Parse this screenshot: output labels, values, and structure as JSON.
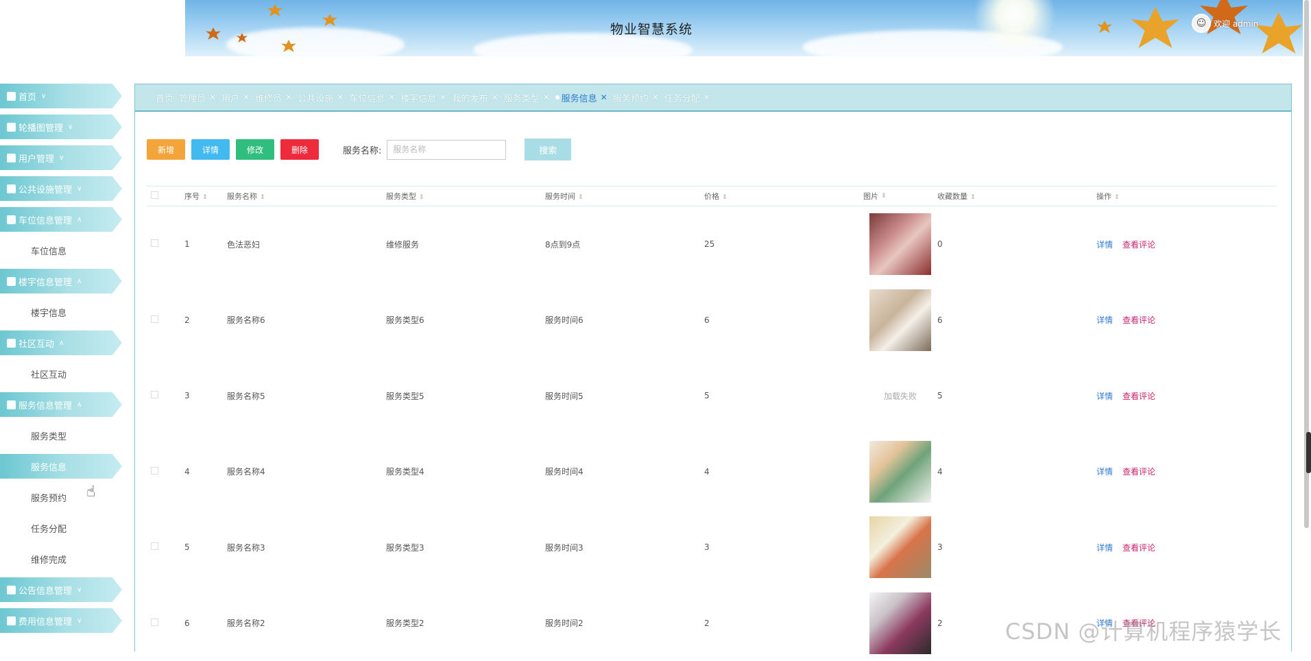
{
  "header": {
    "title": "物业智慧系统",
    "welcome": "欢迎 admin",
    "avatar_icon": "user-avatar-icon"
  },
  "sidebar": {
    "items": [
      {
        "label": "首页",
        "icon": "home-icon",
        "expanded": false,
        "children": []
      },
      {
        "label": "轮播图管理",
        "icon": "carousel-icon",
        "expanded": false,
        "children": []
      },
      {
        "label": "用户管理",
        "icon": "user-icon",
        "expanded": false,
        "children": []
      },
      {
        "label": "公共设施管理",
        "icon": "facility-icon",
        "expanded": false,
        "children": []
      },
      {
        "label": "车位信息管理",
        "icon": "car-icon",
        "expanded": true,
        "children": [
          "车位信息"
        ]
      },
      {
        "label": "楼宇信息管理",
        "icon": "building-icon",
        "expanded": true,
        "children": [
          "楼宇信息"
        ]
      },
      {
        "label": "社区互动",
        "icon": "community-icon",
        "expanded": true,
        "children": [
          "社区互动"
        ]
      },
      {
        "label": "服务信息管理",
        "icon": "service-icon",
        "expanded": true,
        "children": [
          "服务类型",
          "服务信息",
          "服务预约",
          "任务分配",
          "维修完成"
        ]
      },
      {
        "label": "公告信息管理",
        "icon": "notice-icon",
        "expanded": false,
        "children": []
      },
      {
        "label": "费用信息管理",
        "icon": "fee-icon",
        "expanded": false,
        "children": []
      }
    ],
    "active_child": "服务信息"
  },
  "tabs": [
    {
      "label": "首页",
      "closable": false
    },
    {
      "label": "管理员",
      "closable": true
    },
    {
      "label": "用户",
      "closable": true
    },
    {
      "label": "维修员",
      "closable": true
    },
    {
      "label": "公共设施",
      "closable": true
    },
    {
      "label": "车位信息",
      "closable": true
    },
    {
      "label": "楼宇信息",
      "closable": true
    },
    {
      "label": "我的发布",
      "closable": true
    },
    {
      "label": "服务类型",
      "closable": true
    },
    {
      "label": "服务信息",
      "closable": true,
      "active": true
    },
    {
      "label": "服务预约",
      "closable": true
    },
    {
      "label": "任务分配",
      "closable": true
    }
  ],
  "toolbar": {
    "add_label": "新增",
    "detail_label": "详情",
    "edit_label": "修改",
    "delete_label": "删除",
    "search_label": "服务名称:",
    "search_placeholder": "服务名称",
    "search_button": "搜索"
  },
  "table": {
    "columns": [
      "序号",
      "服务名称",
      "服务类型",
      "服务时间",
      "价格",
      "图片",
      "收藏数量",
      "操作"
    ],
    "rows": [
      {
        "idx": "1",
        "name": "色法恶妇",
        "type": "维修服务",
        "time": "8点到9点",
        "price": "25",
        "image": "img1",
        "fav": "0"
      },
      {
        "idx": "2",
        "name": "服务名称6",
        "type": "服务类型6",
        "time": "服务时间6",
        "price": "6",
        "image": "img2",
        "fav": "6"
      },
      {
        "idx": "3",
        "name": "服务名称5",
        "type": "服务类型5",
        "time": "服务时间5",
        "price": "5",
        "image": "fail",
        "fav": "5"
      },
      {
        "idx": "4",
        "name": "服务名称4",
        "type": "服务类型4",
        "time": "服务时间4",
        "price": "4",
        "image": "img3",
        "fav": "4"
      },
      {
        "idx": "5",
        "name": "服务名称3",
        "type": "服务类型3",
        "time": "服务时间3",
        "price": "3",
        "image": "img4",
        "fav": "3"
      },
      {
        "idx": "6",
        "name": "服务名称2",
        "type": "服务类型2",
        "time": "服务时间2",
        "price": "2",
        "image": "img5",
        "fav": "2"
      }
    ],
    "image_fail_text": "加载失败",
    "op_detail": "详情",
    "op_review": "查看评论"
  },
  "watermark": "CSDN @计算机程序猿学长",
  "colors": {
    "menu_gradient_start": "#6cc7d1",
    "tab_bar_bg": "#c3e6eb",
    "add": "#f4a53a",
    "detail": "#42b9ef",
    "edit": "#2fbe7d",
    "delete": "#ee2a3d",
    "search": "#a8dde6",
    "link_detail": "#2e7bcf",
    "link_review": "#c7246e"
  }
}
